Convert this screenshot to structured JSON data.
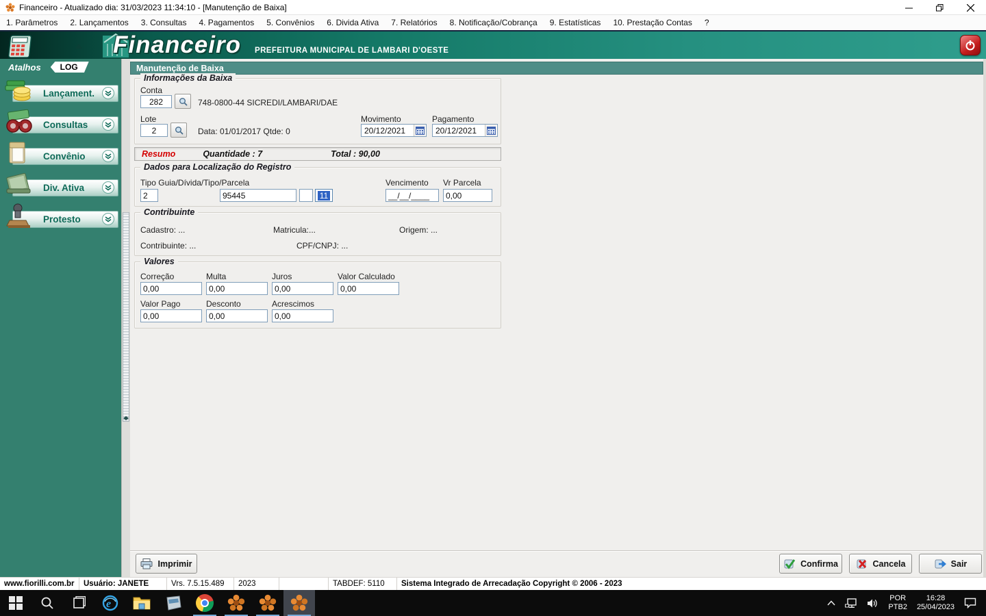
{
  "window": {
    "title": "Financeiro - Atualizado dia: 31/03/2023 11:34:10 - [Manutenção de Baixa]"
  },
  "menu": {
    "items": [
      "1. Parâmetros",
      "2. Lançamentos",
      "3. Consultas",
      "4. Pagamentos",
      "5. Convênios",
      "6. Divida Ativa",
      "7. Relatórios",
      "8. Notificação/Cobrança",
      "9. Estatísticas",
      "10. Prestação Contas",
      "?"
    ]
  },
  "header": {
    "app_name": "Financeiro",
    "subtitle": "PREFEITURA MUNICIPAL DE LAMBARI D'OESTE",
    "icons": [
      "calculator-icon",
      "collapse-arrow-icon",
      "emblem-icon",
      "coins-image",
      "power-icon"
    ]
  },
  "sidebar": {
    "header": "Atalhos",
    "log_badge": "LOG",
    "items": [
      {
        "label": "Lançament.",
        "icon": "ledger-coins-icon"
      },
      {
        "label": "Consultas",
        "icon": "binoculars-icon"
      },
      {
        "label": "Convênio",
        "icon": "folder-icon"
      },
      {
        "label": "Div. Ativa",
        "icon": "book-icon"
      },
      {
        "label": "Protesto",
        "icon": "stamp-icon"
      }
    ]
  },
  "form": {
    "title": "Manutenção de Baixa",
    "info": {
      "group_title": "Informações da Baixa",
      "conta_label": "Conta",
      "conta_value": "282",
      "conta_desc": "748-0800-44 SICREDI/LAMBARI/DAE",
      "lote_label": "Lote",
      "lote_value": "2",
      "lote_desc": "Data: 01/01/2017 Qtde: 0",
      "movimento_label": "Movimento",
      "movimento_value": "20/12/2021",
      "pagamento_label": "Pagamento",
      "pagamento_value": "20/12/2021"
    },
    "resumo": {
      "label": "Resumo",
      "quantidade": "Quantidade : 7",
      "total": "Total : 90,00",
      "label_color": "#d40000"
    },
    "localizacao": {
      "group_title": "Dados para Localização do Registro",
      "fields_label": "Tipo Guia/Dívida/Tipo/Parcela",
      "tipo_value": "2",
      "guia_value": "95445",
      "divida_value": "",
      "parcela_value": "11",
      "vencimento_label": "Vencimento",
      "vencimento_value": "__/__/____",
      "vr_parcela_label": "Vr Parcela",
      "vr_parcela_value": "0,00"
    },
    "contribuinte": {
      "group_title": "Contribuinte",
      "cadastro": "Cadastro: ...",
      "matricula": "Matricula:...",
      "origem": "Origem: ...",
      "contribuinte": "Contribuinte: ...",
      "cpf_cnpj": "CPF/CNPJ: ..."
    },
    "valores": {
      "group_title": "Valores",
      "row1": [
        {
          "label": "Correção",
          "value": "0,00"
        },
        {
          "label": "Multa",
          "value": "0,00"
        },
        {
          "label": "Juros",
          "value": "0,00"
        },
        {
          "label": "Valor Calculado",
          "value": "0,00"
        }
      ],
      "row2": [
        {
          "label": "Valor Pago",
          "value": "0,00"
        },
        {
          "label": "Desconto",
          "value": "0,00"
        },
        {
          "label": "Acrescimos",
          "value": "0,00"
        }
      ]
    },
    "buttons": {
      "imprimir": "Imprimir",
      "confirma": "Confirma",
      "cancela": "Cancela",
      "sair": "Sair"
    }
  },
  "statusbar": {
    "segments": [
      "www.fiorilli.com.br",
      "Usuário: JANETE",
      "Vrs. 7.5.15.489",
      "2023",
      "",
      "TABDEF: 5110",
      "Sistema Integrado de Arrecadação Copyright © 2006 - 2023"
    ]
  },
  "taskbar": {
    "icons": [
      "start-icon",
      "search-icon",
      "task-view-icon",
      "internet-explorer-icon",
      "file-explorer-icon",
      "app-window-icon",
      "chrome-icon",
      "fiorilli-app-icon",
      "fiorilli-app-icon",
      "fiorilli-app-icon"
    ],
    "tray": {
      "lang_top": "POR",
      "lang_bottom": "PTB2",
      "time": "16:28",
      "date": "25/04/2023"
    }
  },
  "colors": {
    "banner_teal": "#157a68",
    "sidebar_teal": "#34806f",
    "form_titlebar": "#4f8d87",
    "resumo_red": "#d40000",
    "selection_blue": "#2f63c4",
    "taskbar_black": "#0c0c0c"
  }
}
